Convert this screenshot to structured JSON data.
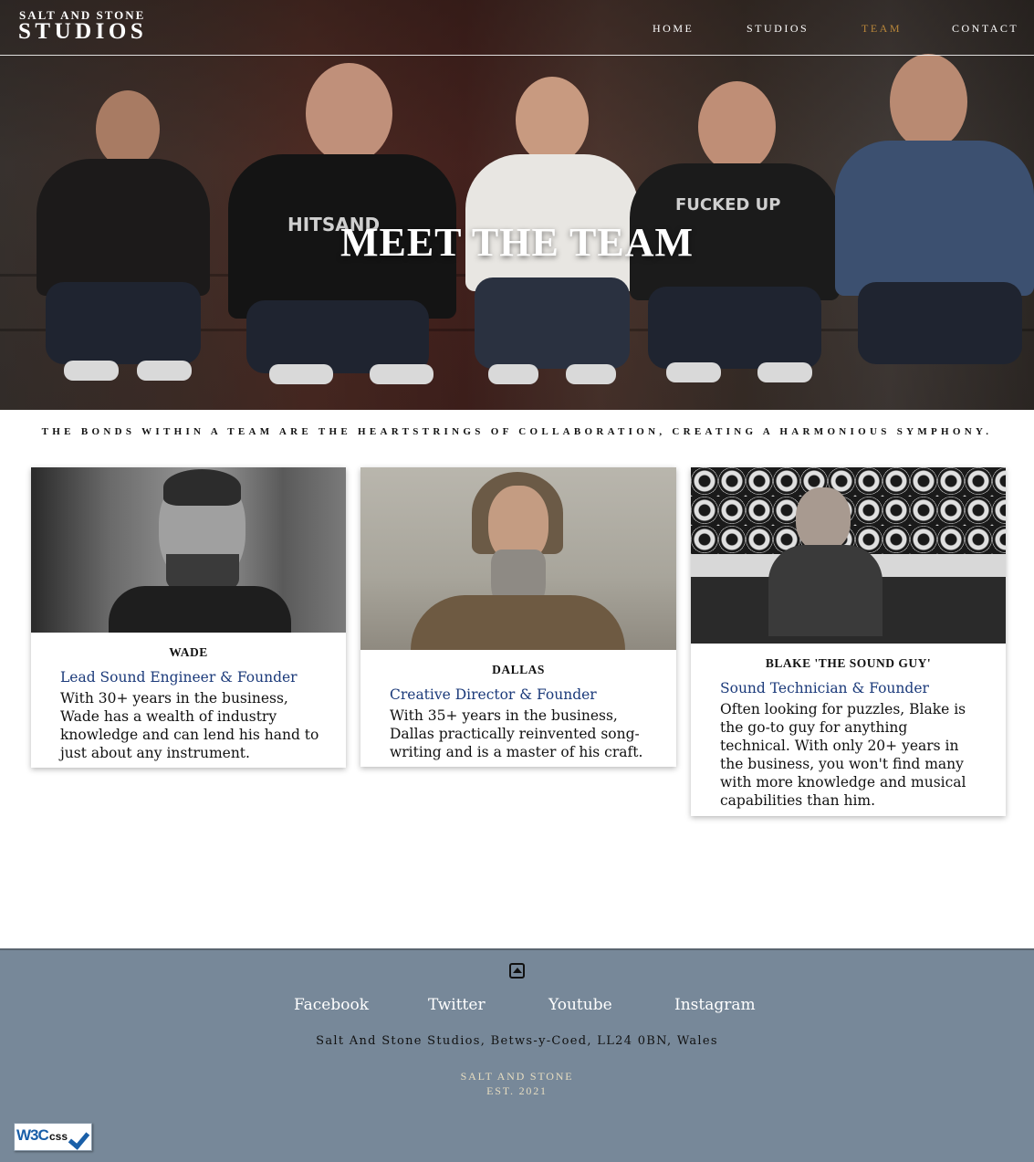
{
  "nav": {
    "brand_top": "SALT AND STONE",
    "brand_main": "STUDIOS",
    "links": [
      {
        "label": "HOME",
        "active": false
      },
      {
        "label": "STUDIOS",
        "active": false
      },
      {
        "label": "TEAM",
        "active": true
      },
      {
        "label": "CONTACT",
        "active": false
      }
    ]
  },
  "hero": {
    "title": "MEET THE TEAM",
    "shirt_text_1": "HITSAND",
    "shirt_text_2": "FUCKED UP"
  },
  "tagline": "THE BONDS WITHIN A TEAM ARE THE HEARTSTRINGS OF COLLABORATION, CREATING A HARMONIOUS SYMPHONY.",
  "team": [
    {
      "name": "WADE",
      "role": "Lead Sound Engineer & Founder",
      "bio": "With 30+ years in the business, Wade has a wealth of industry knowledge and can lend his hand to just about any instrument."
    },
    {
      "name": "DALLAS",
      "role": "Creative Director & Founder",
      "bio": "With 35+ years in the business, Dallas practically reinvented song-writing and is a master of his craft."
    },
    {
      "name": "BLAKE 'THE SOUND GUY'",
      "role": "Sound Technician & Founder",
      "bio": "Often looking for puzzles, Blake is the go-to guy for anything technical. With only 20+ years in the business, you won't find many with more knowledge and musical capabilities than him."
    }
  ],
  "footer": {
    "back_to_top_icon": "caret-up-square-icon",
    "social": [
      "Facebook",
      "Twitter",
      "Youtube",
      "Instagram"
    ],
    "address": "Salt And Stone Studios, Betws-y-Coed, LL24 0BN, Wales",
    "brand_line1": "SALT AND STONE",
    "brand_line2": "EST. 2021",
    "badge_w3c": "W3C",
    "badge_css": "css"
  },
  "colors": {
    "active_nav": "#b8863a",
    "role_text": "#1b3a7a",
    "footer_bg": "#778899",
    "footer_brand": "#e6dcc0"
  }
}
